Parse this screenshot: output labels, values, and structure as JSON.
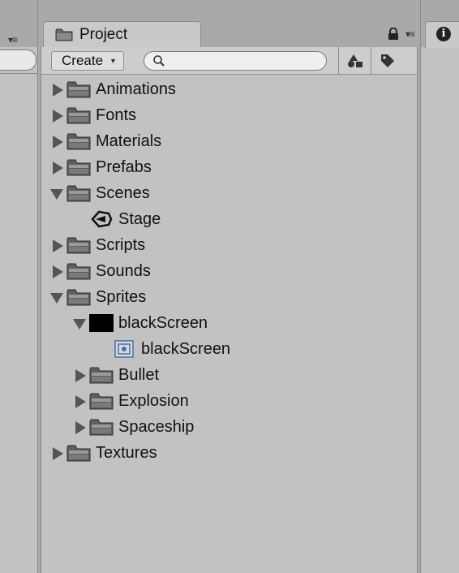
{
  "left_panel": {
    "menu_glyph": "▾≡"
  },
  "project": {
    "tab_label": "Project",
    "menu_glyph": "▾≡",
    "toolbar": {
      "create_label": "Create",
      "create_arrow": "▼",
      "search_placeholder": ""
    }
  },
  "tree": [
    {
      "label": "Animations",
      "depth": 0,
      "expand": "collapsed",
      "icon": "folder-icon"
    },
    {
      "label": "Fonts",
      "depth": 0,
      "expand": "collapsed",
      "icon": "folder-icon"
    },
    {
      "label": "Materials",
      "depth": 0,
      "expand": "collapsed",
      "icon": "folder-icon"
    },
    {
      "label": "Prefabs",
      "depth": 0,
      "expand": "collapsed",
      "icon": "folder-icon"
    },
    {
      "label": "Scenes",
      "depth": 0,
      "expand": "expanded",
      "icon": "folder-icon"
    },
    {
      "label": "Stage",
      "depth": 1,
      "expand": "none",
      "icon": "unity-scene-icon"
    },
    {
      "label": "Scripts",
      "depth": 0,
      "expand": "collapsed",
      "icon": "folder-icon"
    },
    {
      "label": "Sounds",
      "depth": 0,
      "expand": "collapsed",
      "icon": "folder-icon"
    },
    {
      "label": "Sprites",
      "depth": 0,
      "expand": "expanded",
      "icon": "folder-icon"
    },
    {
      "label": "blackScreen",
      "depth": 1,
      "expand": "expanded",
      "icon": "black-texture-icon"
    },
    {
      "label": "blackScreen",
      "depth": 2,
      "expand": "none",
      "icon": "sprite-icon"
    },
    {
      "label": "Bullet",
      "depth": 1,
      "expand": "collapsed",
      "icon": "folder-icon"
    },
    {
      "label": "Explosion",
      "depth": 1,
      "expand": "collapsed",
      "icon": "folder-icon"
    },
    {
      "label": "Spaceship",
      "depth": 1,
      "expand": "collapsed",
      "icon": "folder-icon"
    },
    {
      "label": "Textures",
      "depth": 0,
      "expand": "collapsed",
      "icon": "folder-icon"
    }
  ],
  "inspector": {
    "info_glyph": "i"
  },
  "colors": {
    "background": "#a9a9a9",
    "panel": "#c2c2c2",
    "folder": "#6e6e6e",
    "arrow": "#555555"
  }
}
